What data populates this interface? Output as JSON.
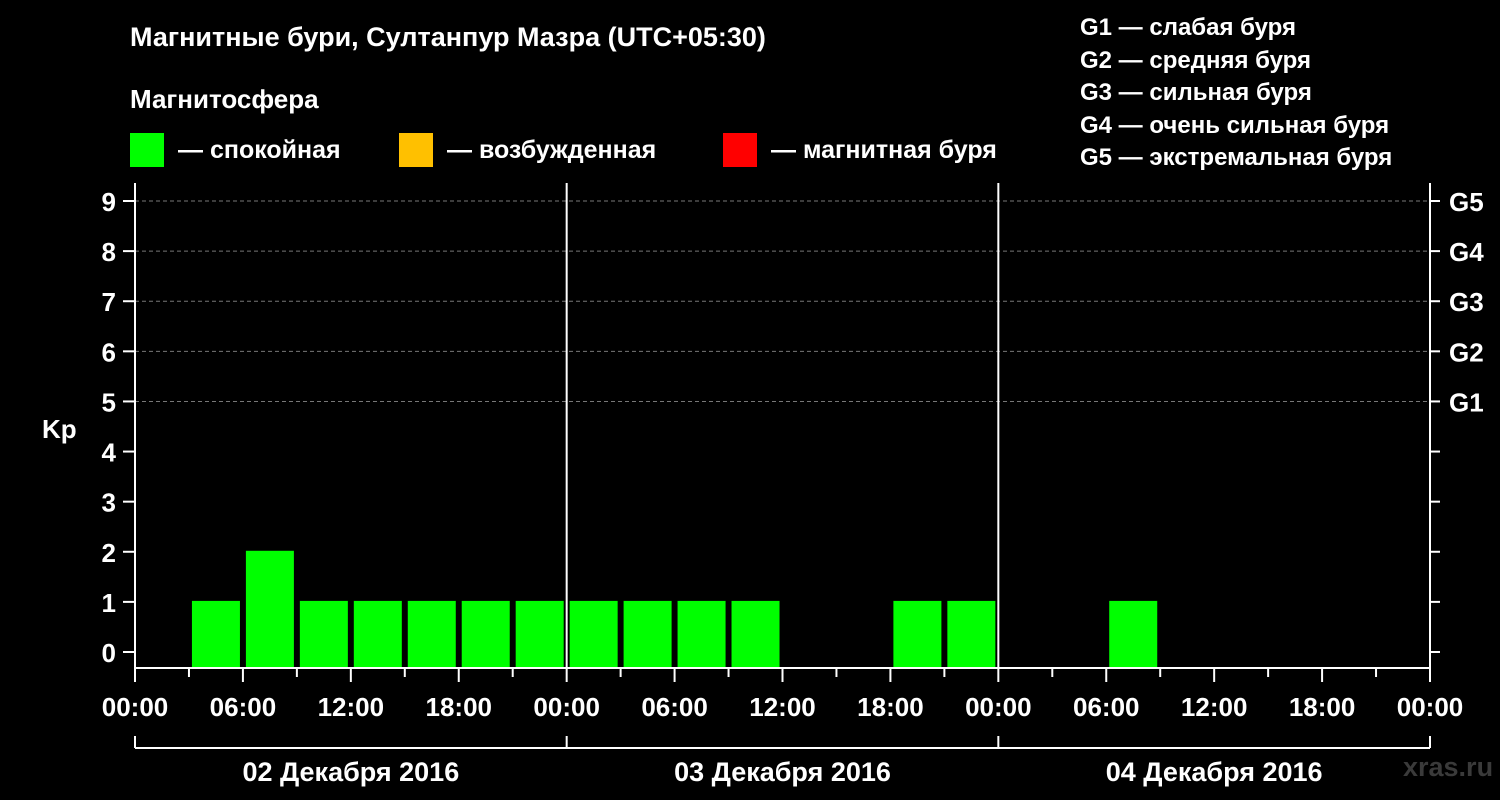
{
  "header": {
    "title": "Магнитные бури, Султанпур Мазра (UTC+05:30)",
    "subtitle": "Магнитосфера"
  },
  "legend": [
    {
      "label": "— спокойная",
      "color": "#00ff00"
    },
    {
      "label": "— возбужденная",
      "color": "#ffc000"
    },
    {
      "label": "— магнитная буря",
      "color": "#ff0000"
    }
  ],
  "storm_levels": [
    "G1 — слабая буря",
    "G2 — средняя буря",
    "G3 — сильная буря",
    "G4 — очень сильная буря",
    "G5 — экстремальная буря"
  ],
  "watermark": "xras.ru",
  "chart_data": {
    "type": "bar",
    "ylabel": "Kp",
    "ylim": [
      0,
      9
    ],
    "y_ticks": [
      "0",
      "1",
      "2",
      "3",
      "4",
      "5",
      "6",
      "7",
      "8",
      "9"
    ],
    "right_ticks": [
      {
        "value": 5,
        "label": "G1"
      },
      {
        "value": 6,
        "label": "G2"
      },
      {
        "value": 7,
        "label": "G3"
      },
      {
        "value": 8,
        "label": "G4"
      },
      {
        "value": 9,
        "label": "G5"
      }
    ],
    "x_tick_labels": [
      "00:00",
      "06:00",
      "12:00",
      "18:00",
      "00:00",
      "06:00",
      "12:00",
      "18:00",
      "00:00",
      "06:00",
      "12:00",
      "18:00",
      "00:00"
    ],
    "days": [
      "02 Декабря 2016",
      "03 Декабря 2016",
      "04 Декабря 2016"
    ],
    "grid": true,
    "bar_interval_hours": 3,
    "categories": [
      "02.12 00:00",
      "02.12 03:00",
      "02.12 06:00",
      "02.12 09:00",
      "02.12 12:00",
      "02.12 15:00",
      "02.12 18:00",
      "02.12 21:00",
      "03.12 00:00",
      "03.12 03:00",
      "03.12 06:00",
      "03.12 09:00",
      "03.12 12:00",
      "03.12 15:00",
      "03.12 18:00",
      "03.12 21:00",
      "04.12 00:00",
      "04.12 03:00",
      "04.12 06:00",
      "04.12 09:00",
      "04.12 12:00",
      "04.12 15:00",
      "04.12 18:00",
      "04.12 21:00"
    ],
    "values": [
      null,
      1,
      2,
      1,
      1,
      1,
      1,
      1,
      1,
      1,
      1,
      1,
      null,
      null,
      1,
      1,
      null,
      null,
      1,
      null,
      null,
      null,
      null,
      null
    ],
    "bar_color": "#00ff00"
  }
}
